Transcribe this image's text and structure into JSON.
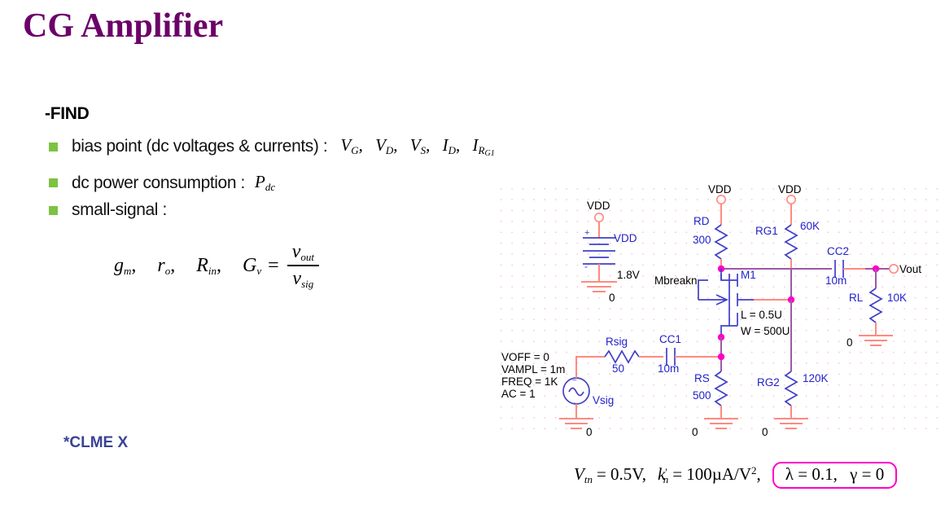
{
  "slide": {
    "title": "CG Amplifier",
    "find_heading": "-FIND",
    "footnote": "*CLME X"
  },
  "bullets": [
    {
      "text": "bias point (dc voltages & currents) :",
      "math": [
        "V_G",
        "V_D",
        "V_S",
        "I_D",
        "I_RG1"
      ],
      "vars": {
        "v": "V",
        "i": "I",
        "g": "G",
        "d": "D",
        "s": "S",
        "rg1_r": "R",
        "rg1_n": "G1"
      }
    },
    {
      "text": "dc power consumption :",
      "math": [
        "P_dc"
      ],
      "p": "P",
      "p_sub": "dc"
    },
    {
      "text": "small-signal  :",
      "math": []
    }
  ],
  "formula": {
    "gm": "g",
    "gm_sub": "m",
    "ro": "r",
    "ro_sub": "o",
    "rin": "R",
    "rin_sub": "in",
    "gv": "G",
    "gv_sub": "v",
    "equals": "=",
    "num": "v",
    "num_sub": "out",
    "den": "v",
    "den_sub": "sig",
    "comma": ","
  },
  "params": {
    "vtn": "V",
    "vtn_sub": "tn",
    "vtn_val": "= 0.5V,",
    "kn": "k",
    "kn_sub": "n",
    "kn_prime": "'",
    "kn_val": "= 100µA/V",
    "kn_exp": "2",
    "kn_comma": ",",
    "lambda": "λ = 0.1,",
    "gamma": "γ = 0",
    "box_color": "#ff00c8"
  },
  "schematic": {
    "sources": {
      "vdd_supply_terminal": "VDD",
      "vdd_supply_name": "VDD",
      "vdd_value": "1.8V",
      "gnd_label": "0",
      "vsig_name": "Vsig",
      "vsig_params": [
        "VOFF = 0",
        "VAMPL = 1m",
        "FREQ = 1K",
        "AC = 1"
      ]
    },
    "rails": [
      {
        "name": "VDD",
        "id": "vdd-rail-rd"
      },
      {
        "name": "VDD",
        "id": "vdd-rail-rg1"
      }
    ],
    "components": [
      {
        "ref": "RD",
        "value": "300"
      },
      {
        "ref": "RG1",
        "value": "60K"
      },
      {
        "ref": "RG2",
        "value": "120K"
      },
      {
        "ref": "RS",
        "value": "500"
      },
      {
        "ref": "RL",
        "value": "10K"
      },
      {
        "ref": "Rsig",
        "value": "50"
      },
      {
        "ref": "CC1",
        "value": "10m"
      },
      {
        "ref": "CC2",
        "value": "10m"
      }
    ],
    "transistor": {
      "model": "Mbreakn",
      "ref": "M1",
      "length": "L = 0.5U",
      "width": "W = 500U"
    },
    "nodes": {
      "output": "Vout"
    },
    "grounds": [
      "0",
      "0",
      "0",
      "0",
      "0"
    ],
    "colors": {
      "wire_red": "#ff8a80",
      "wire_violet": "#9b59a8",
      "symbol_blue": "#4040c8",
      "junction": "#ff00c8",
      "label_blue": "#2222cc"
    }
  },
  "theme": {
    "title_color": "#6b0069",
    "bullet_color": "#7dc242",
    "footnote_color": "#3b4395",
    "background": "#ffffff"
  }
}
